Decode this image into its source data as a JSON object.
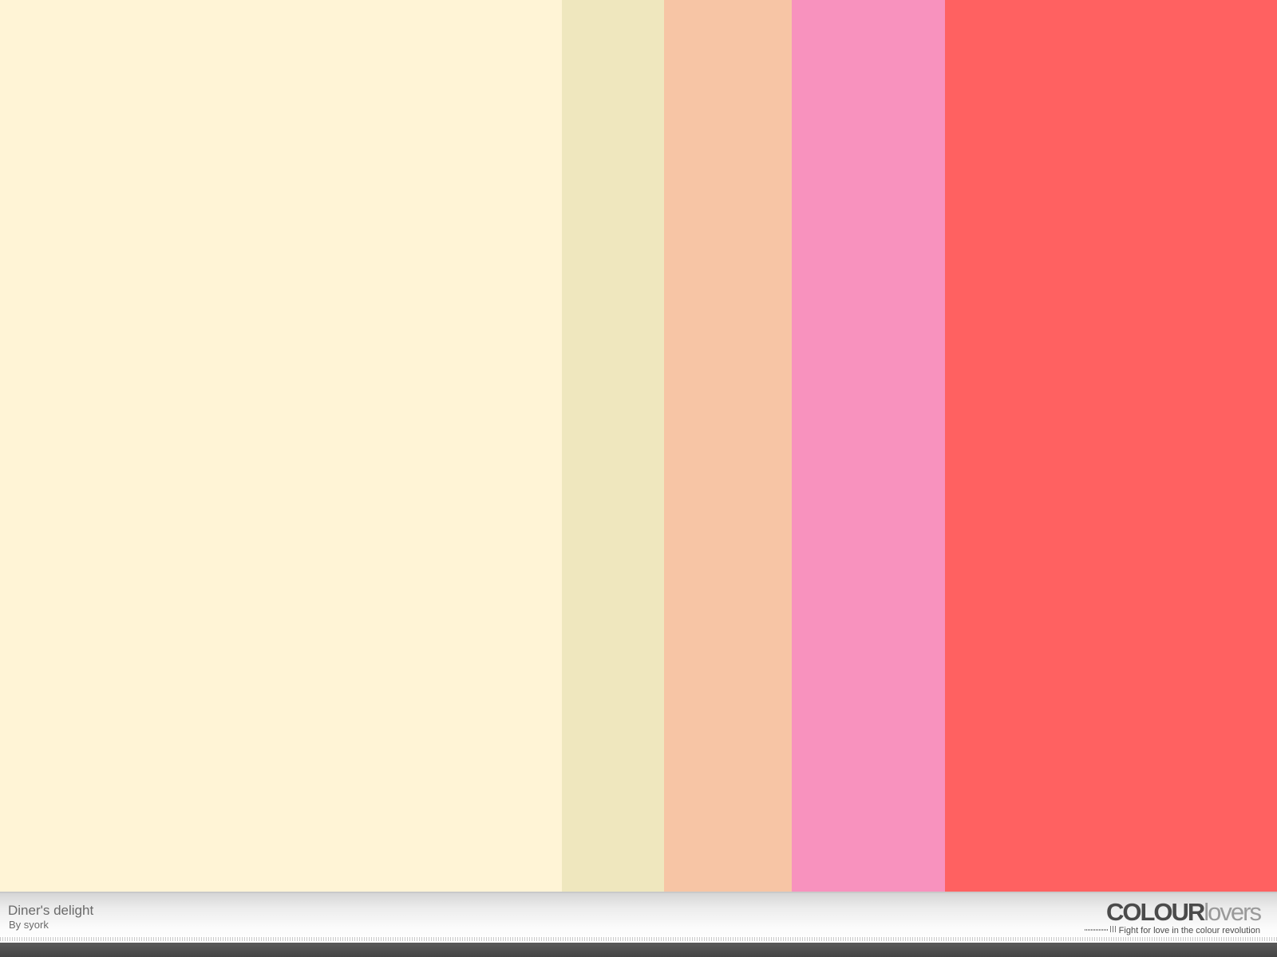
{
  "palette": {
    "title": "Diner's delight",
    "author": "By syork",
    "colors": [
      {
        "hex": "#FFF4D6"
      },
      {
        "hex": "#EFE7BE"
      },
      {
        "hex": "#F7C5A5"
      },
      {
        "hex": "#F892BE"
      },
      {
        "hex": "#FF6161"
      }
    ]
  },
  "branding": {
    "logo_colour": "COLOUR",
    "logo_lovers": "lovers",
    "tagline": "Fight for love in the colour revolution"
  },
  "colors": {
    "footer_text": "#6a6a6a",
    "logo_dark": "#4b4b4b",
    "logo_light": "#9a9a9a",
    "bottom_bar": "#4a4a4a"
  }
}
